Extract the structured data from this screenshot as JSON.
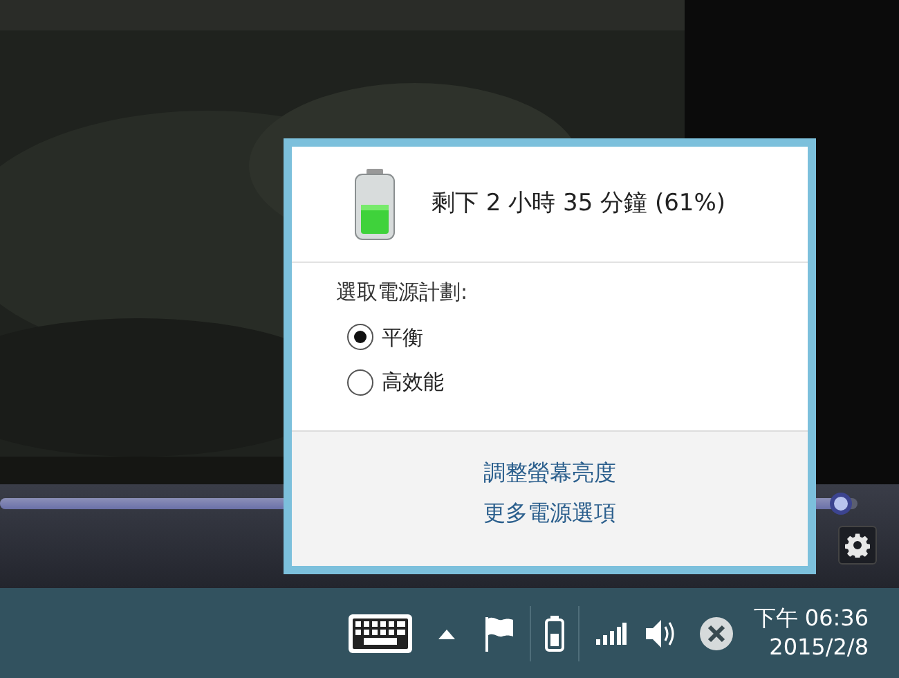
{
  "player": {
    "seek": {
      "level": 0.98
    }
  },
  "popup": {
    "status": "剩下 2 小時 35 分鐘 (61%)",
    "plan_label": "選取電源計劃:",
    "plans": [
      {
        "label": "平衡",
        "selected": true
      },
      {
        "label": "高效能",
        "selected": false
      }
    ],
    "links": [
      "調整螢幕亮度",
      "更多電源選項"
    ]
  },
  "taskbar": {
    "time": "下午 06:36",
    "date": "2015/2/8"
  }
}
